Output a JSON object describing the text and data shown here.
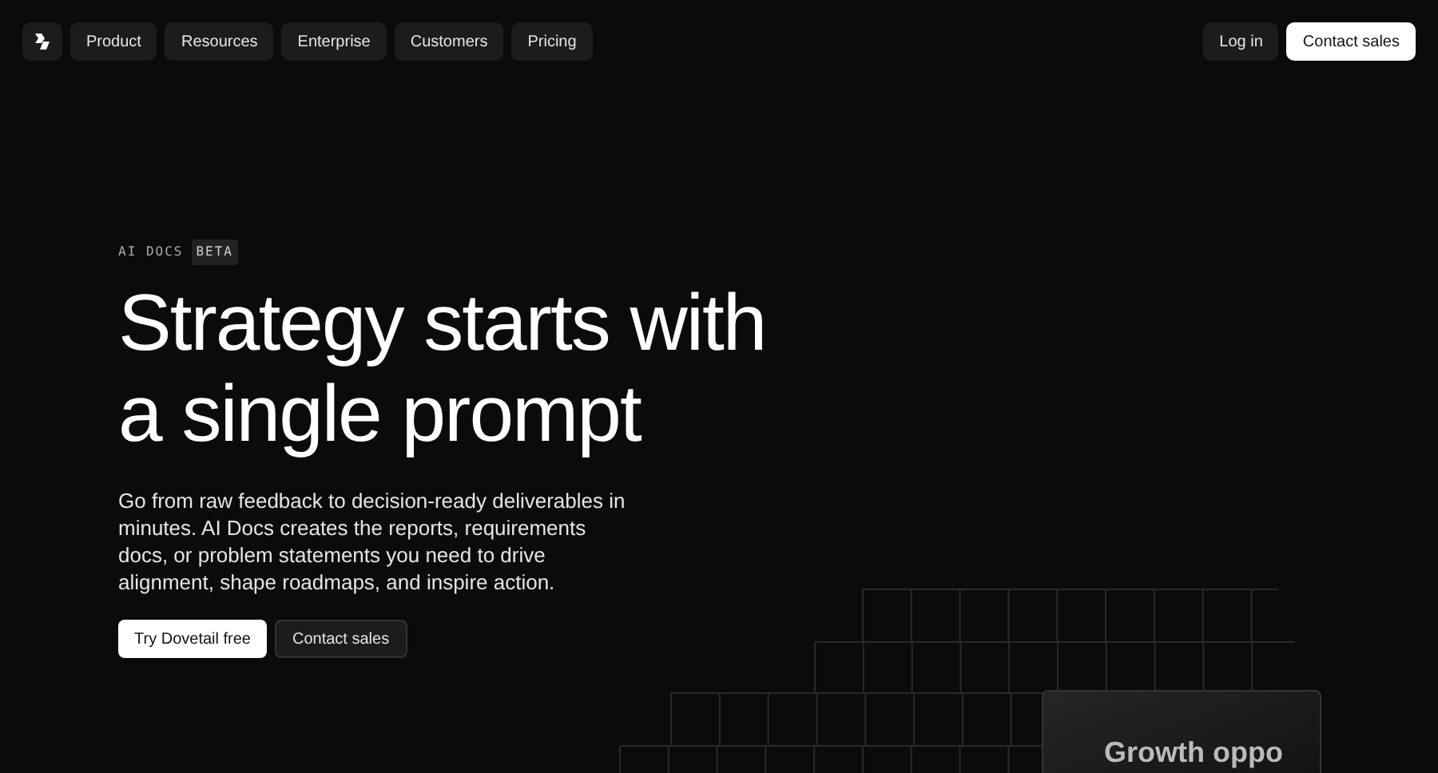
{
  "nav": {
    "items": [
      "Product",
      "Resources",
      "Enterprise",
      "Customers",
      "Pricing"
    ],
    "login": "Log in",
    "contact": "Contact sales"
  },
  "hero": {
    "eyebrow": "AI DOCS",
    "badge": "BETA",
    "title_lines": [
      "Strategy starts with",
      "a single prompt"
    ],
    "description": "Go from raw feedback to decision-ready deliverables in minutes. AI Docs creates the reports, requirements docs, or problem statements you need to drive alignment, shape roadmaps, and inspire action.",
    "primary_button": "Try Dovetail free",
    "secondary_button": "Contact sales"
  },
  "preview_card": {
    "title": "Growth oppo"
  }
}
